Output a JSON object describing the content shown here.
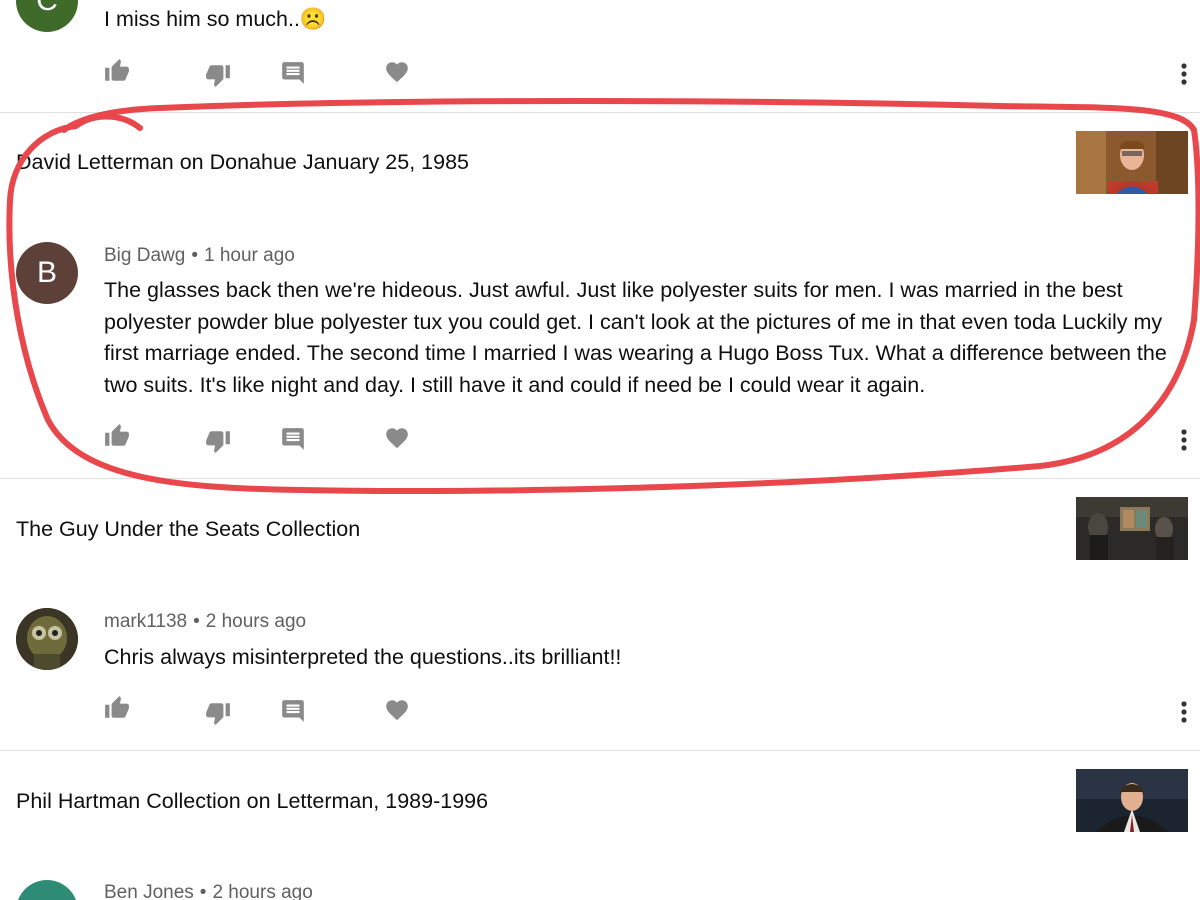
{
  "comments": [
    {
      "avatar_letter": "C",
      "avatar_color": "#3e6b2a",
      "text": "I miss him so much..☹️"
    },
    {
      "video_title": "David Letterman on Donahue January 25, 1985",
      "author": "Big Dawg",
      "separator": "•",
      "time": "1 hour ago",
      "avatar_letter": "B",
      "avatar_color": "#5d4037",
      "text": "The glasses back then we're hideous. Just awful. Just like polyester suits for men. I was married in the best polyester powder blue polyester tux you could get. I can't look at the pictures of me in that even toda  Luckily my first marriage ended. The second time I married I was  wearing a Hugo Boss Tux. What a difference between the two suits. It's like night and day. I still have it and could if need be I could wear it again."
    },
    {
      "video_title": "The Guy Under the Seats Collection",
      "author": "mark1138",
      "separator": "•",
      "time": "2 hours ago",
      "text": "Chris always misinterpreted the questions..its brilliant!!"
    },
    {
      "video_title": "Phil Hartman Collection on Letterman, 1989-1996",
      "author": "Ben Jones",
      "separator": "•",
      "time": "2 hours ago",
      "avatar_color": "#2e8b75"
    }
  ],
  "icons": {
    "like": "thumb-up-icon",
    "dislike": "thumb-down-icon",
    "reply": "comment-icon",
    "heart": "heart-icon",
    "more": "more-vert-icon"
  },
  "colors": {
    "icon_gray": "#8a8a8a",
    "annotation_red": "#e8474c"
  }
}
